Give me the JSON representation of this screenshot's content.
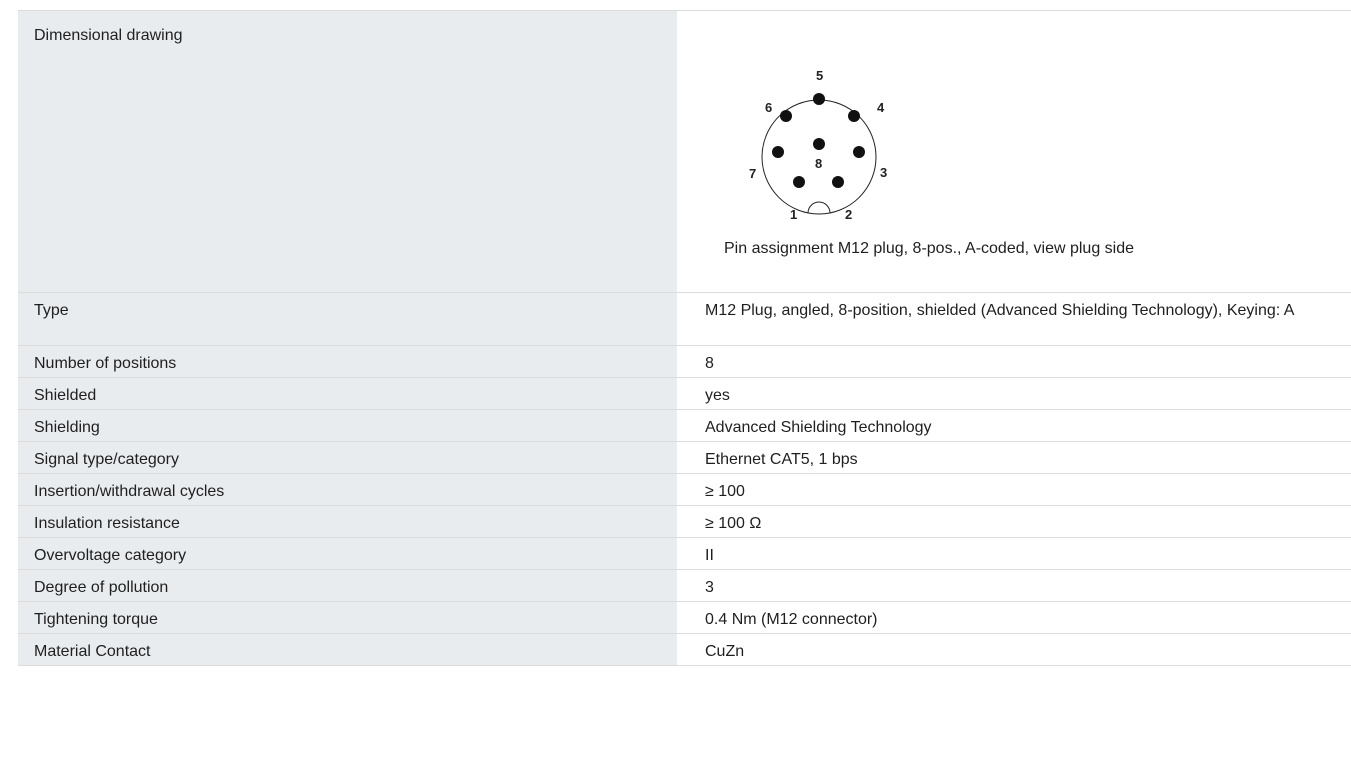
{
  "dimensional": {
    "label": "Dimensional drawing",
    "caption": "Pin assignment M12 plug, 8-pos., A-coded, view plug side",
    "pins": [
      "1",
      "2",
      "3",
      "4",
      "5",
      "6",
      "7",
      "8"
    ]
  },
  "rows": [
    {
      "label": "Type",
      "value": "M12 Plug, angled, 8-position, shielded (Advanced Shielding Technology), Keying: A"
    },
    {
      "label": "Number of positions",
      "value": "8"
    },
    {
      "label": "Shielded",
      "value": "yes"
    },
    {
      "label": "Shielding",
      "value": "Advanced Shielding Technology"
    },
    {
      "label": "Signal type/category",
      "value": "Ethernet CAT5, 1 bps"
    },
    {
      "label": "Insertion/withdrawal cycles",
      "value": "≥ 100"
    },
    {
      "label": "Insulation resistance",
      "value": "≥ 100 Ω"
    },
    {
      "label": "Overvoltage category",
      "value": "II"
    },
    {
      "label": "Degree of pollution",
      "value": "3"
    },
    {
      "label": "Tightening torque",
      "value": "0.4 Nm (M12 connector)"
    },
    {
      "label": "Material Contact",
      "value": "CuZn"
    }
  ]
}
